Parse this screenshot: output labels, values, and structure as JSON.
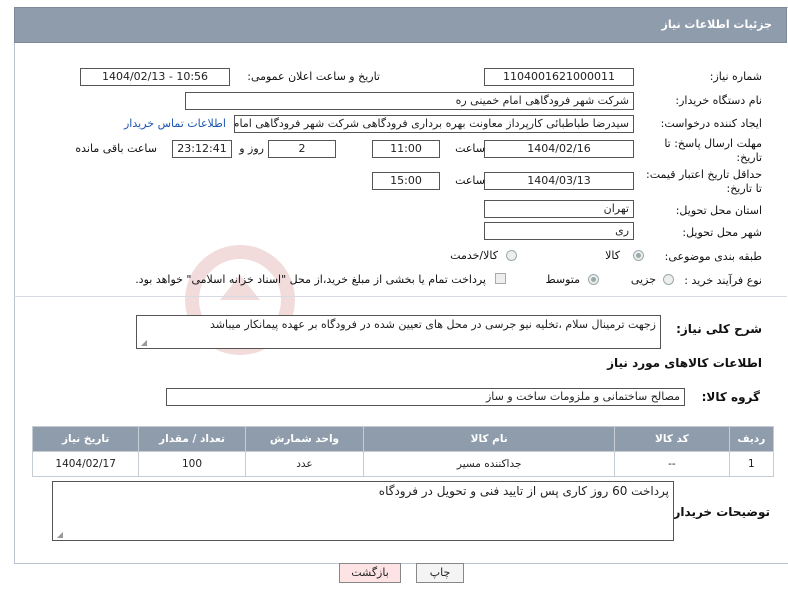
{
  "header": {
    "title": "جزئیات اطلاعات نیاز"
  },
  "form": {
    "need_number_label": "شماره نیاز:",
    "need_number": "1104001621000011",
    "announce_label": "تاریخ و ساعت اعلان عمومی:",
    "announce_value": "1404/02/13 - 10:56",
    "buyer_label": "نام دستگاه خریدار:",
    "buyer_value": "شرکت شهر فرودگاهی امام خمینی  ره",
    "creator_label": "ایجاد کننده درخواست:",
    "creator_value": "سیدرضا طباطبائی کارپرداز معاونت بهره برداری فرودگاهی شرکت شهر فرودگاهی امام خمینی",
    "contact_link": "اطلاعات تماس خریدار",
    "deadline_label_1": "مهلت ارسال پاسخ: تا",
    "deadline_label_2": "تاریخ:",
    "deadline_date": "1404/02/16",
    "time_label": "ساعت",
    "deadline_time": "11:00",
    "days_value": "2",
    "days_label": "روز و",
    "remaining_value": "23:12:41",
    "remaining_label": "ساعت باقی مانده",
    "price_label_1": "حداقل تاریخ اعتبار قیمت:",
    "price_label_2": "تا تاریخ:",
    "price_date": "1404/03/13",
    "price_time": "15:00",
    "province_label": "استان محل تحویل:",
    "province_value": "تهران",
    "city_label": "شهر محل تحویل:",
    "city_value": "ری",
    "category_label": "طبقه بندی موضوعی:",
    "category_goods": "کالا",
    "category_goods_services": "کالا/خدمت",
    "process_label": "نوع فرآیند خرید :",
    "process_partial": "جزیی",
    "process_medium": "متوسط",
    "payment_note": "پرداخت تمام یا بخشی از مبلغ خرید،از محل \"اسناد خزانه اسلامی\" خواهد بود.",
    "desc_label": "شرح کلی نیاز:",
    "desc_value": "زجهت ترمینال سلام ،تخلیه نیو جرسی در محل های تعیین شده در فرودگاه بر عهده پیمانکار میباشد",
    "goods_section_title": "اطلاعات کالاهای مورد نیاز",
    "group_label": "گروه کالا:",
    "group_value": "مصالح ساختمانی و ملزومات ساخت و ساز",
    "buyer_notes_label": "توضیحات خریدار:",
    "buyer_notes_value": "پرداخت 60 روز کاری پس از تایید فنی و تحویل در فرودگاه"
  },
  "table": {
    "headers": [
      "ردیف",
      "کد کالا",
      "نام کالا",
      "واحد شمارش",
      "تعداد / مقدار",
      "تاریخ نیاز"
    ],
    "rows": [
      [
        "1",
        "--",
        "جداکننده مسیر",
        "عدد",
        "100",
        "1404/02/17"
      ]
    ]
  },
  "buttons": {
    "print": "چاپ",
    "back": "بازگشت"
  },
  "colors": {
    "header_bg": "#8f9cac",
    "link": "#1a56b0",
    "watermark": "#e3b0b0"
  }
}
